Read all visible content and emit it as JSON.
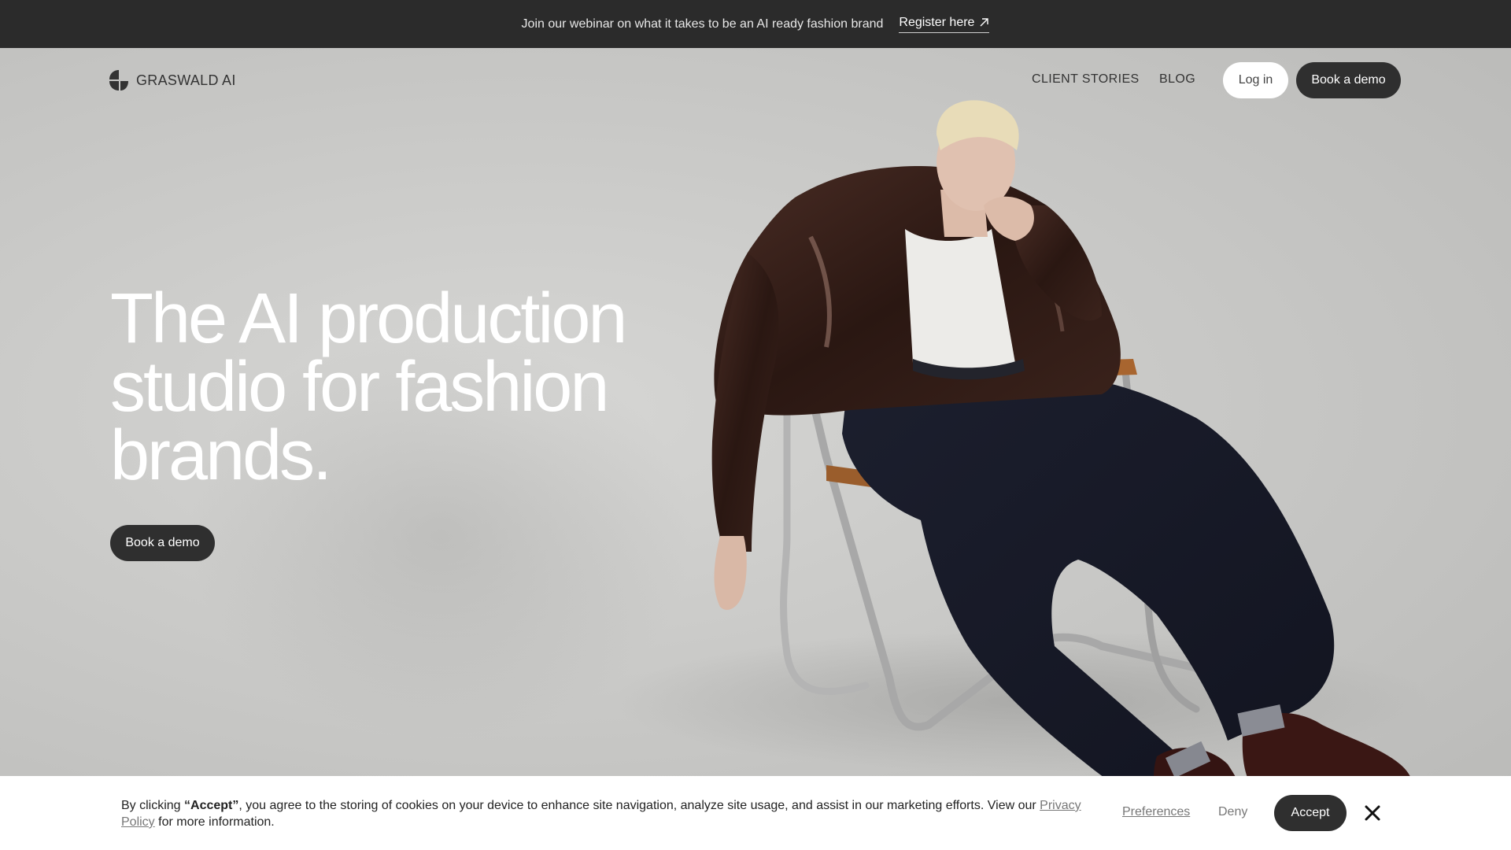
{
  "announcement": {
    "text": "Join our webinar on what it takes to be an AI ready fashion brand",
    "link_label": "Register here",
    "link_icon": "arrow-up-right-icon"
  },
  "nav": {
    "brand": "GRASWALD AI",
    "logo_icon": "graswald-logo-icon",
    "links": [
      "CLIENT STORIES",
      "BLOG"
    ],
    "login_label": "Log in",
    "demo_label": "Book a demo"
  },
  "hero": {
    "headline_lines": [
      "The AI production",
      "studio for fashion",
      "brands."
    ],
    "cta_label": "Book a demo"
  },
  "cookie": {
    "prefix": "By clicking ",
    "accept_quote": "“Accept”",
    "body": ", you agree to the storing of cookies on your device to enhance site navigation, analyze site usage, and assist in our marketing efforts. View our ",
    "policy_link": "Privacy Policy",
    "suffix": " for more information.",
    "preferences_label": "Preferences",
    "deny_label": "Deny",
    "accept_label": "Accept",
    "close_icon": "close-icon"
  },
  "colors": {
    "dark": "#2b2b2b",
    "button_dark": "#2f2f2f",
    "background": "#c9c9c7"
  }
}
